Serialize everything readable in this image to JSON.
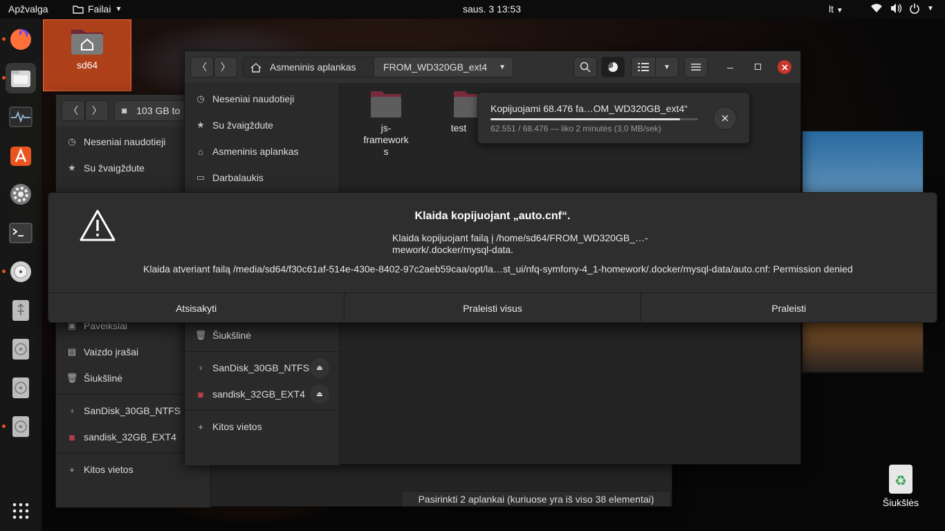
{
  "topbar": {
    "activities": "Apžvalga",
    "app_menu": "Failai",
    "clock": "saus. 3  13:53",
    "lang": "lt"
  },
  "dock": {
    "items": [
      {
        "icon": "firefox-icon"
      },
      {
        "icon": "files-icon"
      },
      {
        "icon": "system-monitor-icon"
      },
      {
        "icon": "software-center-icon"
      },
      {
        "icon": "settings-icon"
      },
      {
        "icon": "terminal-icon"
      },
      {
        "icon": "disk-utility-icon"
      },
      {
        "icon": "usb-drive-icon"
      },
      {
        "icon": "disk-icon"
      },
      {
        "icon": "disk-icon"
      },
      {
        "icon": "disk-icon"
      }
    ],
    "show_apps_icon": "app-grid-icon"
  },
  "desktop": {
    "home_label": "sd64",
    "trash_label": "Šiukšlės"
  },
  "back_window": {
    "path_label": "103 GB to",
    "sidebar": [
      {
        "icon": "clock-icon",
        "label": "Neseniai naudotieji"
      },
      {
        "icon": "star-icon",
        "label": "Su žvaigždute"
      },
      {
        "icon": "pictures-icon",
        "label": "Paveikslai"
      },
      {
        "icon": "video-icon",
        "label": "Vaizdo įrašai"
      },
      {
        "icon": "trash-icon",
        "label": "Šiukšlinė"
      },
      {
        "icon": "usb-icon",
        "label": "SanDisk_30GB_NTFS"
      },
      {
        "icon": "drive-icon",
        "label": "sandisk_32GB_EXT4"
      },
      {
        "icon": "plus-icon",
        "label": "Kitos vietos"
      }
    ],
    "status": "Pasirinkti 2 aplankai  (kuriuose yra iš viso 38 elementai)"
  },
  "front_window": {
    "breadcrumb": [
      "Asmeninis aplankas",
      "FROM_WD320GB_ext4"
    ],
    "sidebar": [
      {
        "icon": "clock-icon",
        "label": "Neseniai naudotieji"
      },
      {
        "icon": "star-icon",
        "label": "Su žvaigždute"
      },
      {
        "icon": "home-icon",
        "label": "Asmeninis aplankas"
      },
      {
        "icon": "desktop-icon",
        "label": "Darbalaukis"
      },
      {
        "icon": "trash-icon",
        "label": "Šiukšlinė"
      },
      {
        "icon": "usb-icon",
        "label": "SanDisk_30GB_NTFS"
      },
      {
        "icon": "drive-icon",
        "label": "sandisk_32GB_EXT4"
      },
      {
        "icon": "plus-icon",
        "label": "Kitos vietos"
      }
    ],
    "files": [
      {
        "name": "js-\nframework\ns"
      },
      {
        "name": "test"
      }
    ]
  },
  "progress": {
    "title": "Kopijuojami 68.476 fa…OM_WD320GB_ext4“",
    "detail": "62.551 / 68.476 — liko 2 minutės (3,0 MB/sek)",
    "fraction": 0.913
  },
  "dialog": {
    "title": "Klaida kopijuojant „auto.cnf“.",
    "message": "Klaida kopijuojant failą į /home/sd64/FROM_WD320GB_…-mework/.docker/mysql-data.",
    "detail": "Klaida atveriant failą /media/sd64/f30c61af-514e-430e-8402-97c2aeb59caa/opt/la…st_ui/nfq-symfony-4_1-homework/.docker/mysql-data/auto.cnf: Permission denied",
    "buttons": [
      "Atsisakyti",
      "Praleisti visus",
      "Praleisti"
    ]
  },
  "colors": {
    "accent": "#e95420",
    "folder": "#7a2a3a",
    "danger": "#c7362b"
  }
}
